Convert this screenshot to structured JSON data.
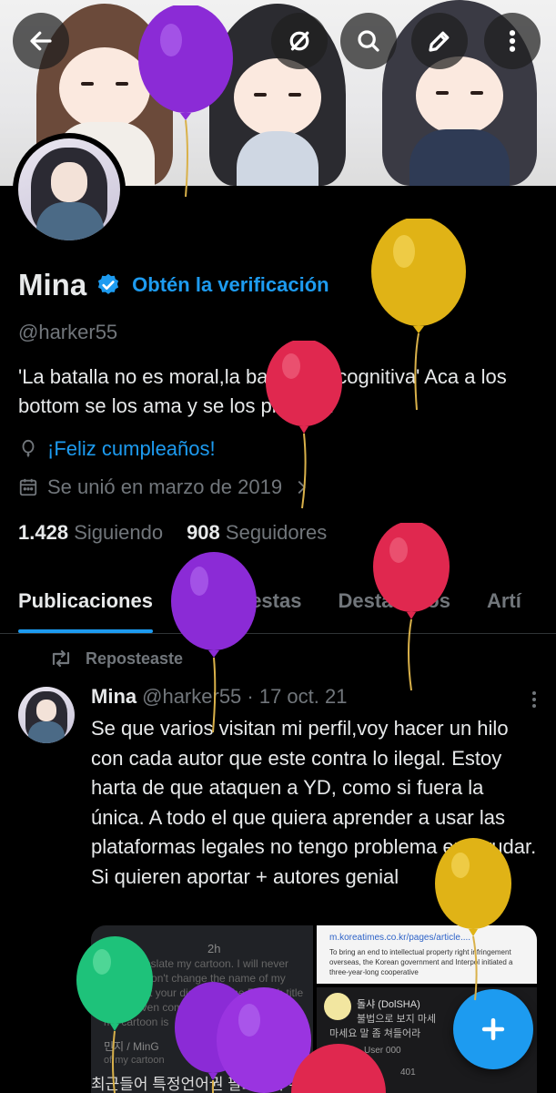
{
  "profile": {
    "name": "Mina",
    "get_verified": "Obtén la verificación",
    "handle": "@harker55",
    "bio": "'La batalla no es moral,la batalla es cognitiva'  Aca a los bottom se los ama y se los protege!",
    "birthday": "¡Feliz cumpleaños!",
    "joined": "Se unió en marzo de 2019",
    "following_count": "1.428",
    "following_label": "Siguiendo",
    "followers_count": "908",
    "followers_label": "Seguidores"
  },
  "tabs": [
    "Publicaciones",
    "Respuestas",
    "Destacados",
    "Artí"
  ],
  "post": {
    "repost_label": "Reposteaste",
    "author": "Mina",
    "meta": "@harker55 · 17 oct. 21",
    "text": "Se que varios  visitan mi perfil,voy hacer un hilo con cada autor que este contra lo ilegal. Estoy harta de que ataquen a YD, como si fuera la única. A todo el que quiera aprender a usar las plataformas legales no tengo problema en ayudar. Si quieren aportar + autores genial"
  },
  "media": {
    "m1_time": "2h",
    "m1_text": "Don't translate my cartoon. I will never allow it. Don't change the name of my cartoon at your disposal. The English title hasn't even come out yet. The name of my cartoon is",
    "m1_user": "민지 / MinG",
    "m1_korean": "최근들어 특정언어권 팔로워가 유난히",
    "m1_korean2": "of my cartoon",
    "m2a_url": "m.koreatimes.co.kr/pages/article....",
    "m2a_text": "To bring an end to intellectual property right infringement overseas, the Korean government and Interpol initiated a three-year-long cooperative",
    "m2b_user": "돌샤 (DolSHA)",
    "m2b_text1": "불법으로 보지 마세",
    "m2b_text2": "마세요 말 좀 쳐들어라",
    "m2b_count1": "User 000",
    "m2b_count2": "401"
  },
  "colors": {
    "accent": "#1d9bf0",
    "muted": "#71767b",
    "text": "#e7e9ea",
    "balloon_purple": "#8b2bd6",
    "balloon_yellow": "#e0b316",
    "balloon_red": "#e0284f",
    "balloon_green": "#1ec27a"
  },
  "icons": [
    "back-arrow-icon",
    "no-visibility-icon",
    "search-icon",
    "edit-pencil-icon",
    "more-vertical-icon",
    "verified-badge-icon",
    "balloon-icon",
    "calendar-icon",
    "chevron-right-icon",
    "repost-icon",
    "more-icon",
    "plus-icon"
  ]
}
